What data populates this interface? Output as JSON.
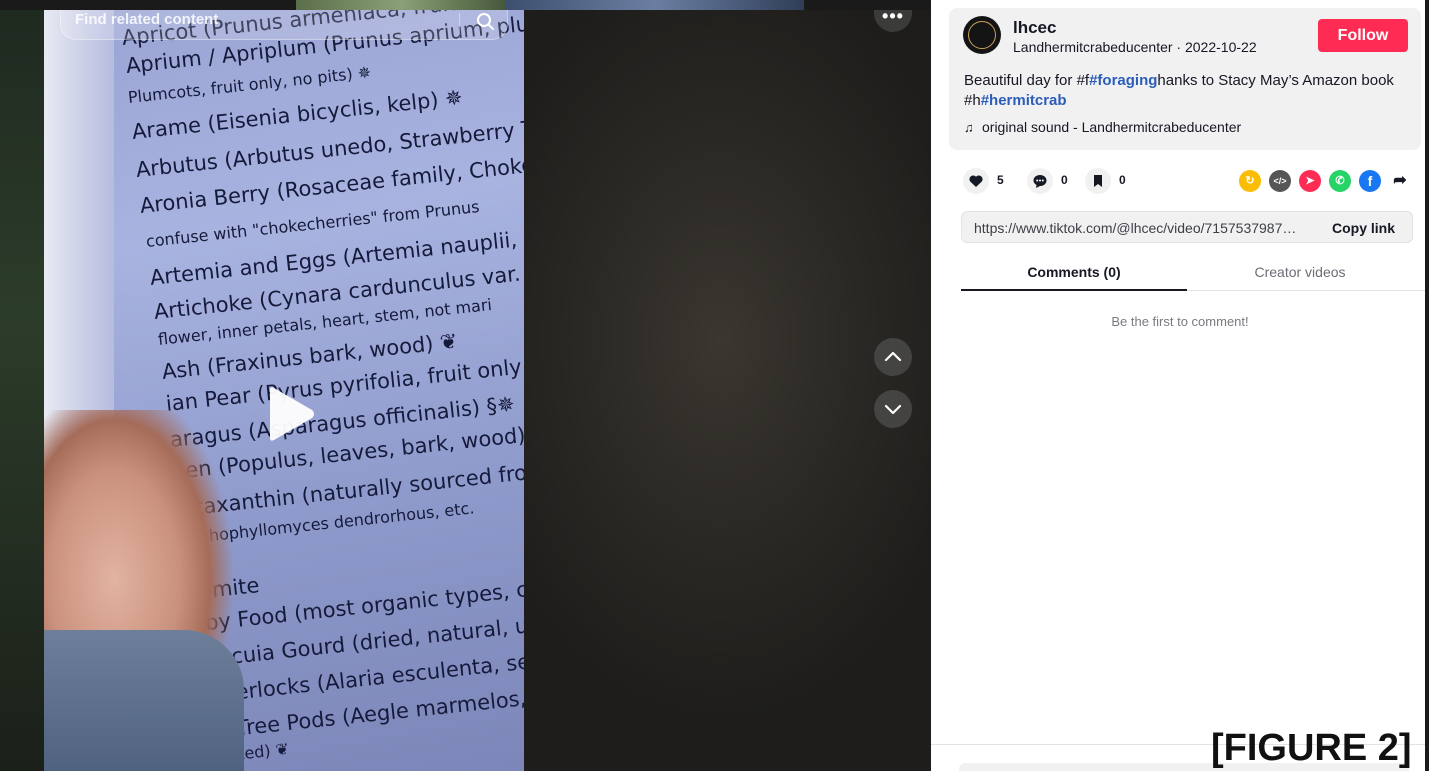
{
  "search": {
    "placeholder": "Find related content"
  },
  "book_text": [
    "Apricot (Prunus armeniaca, fruit only",
    "Aprium / Apriplum (Prunus aprium, plum",
    "Plumcots, fruit only, no pits) ✵",
    "Arame (Eisenia bicyclis, kelp) ✵",
    "Arbutus (Arbutus unedo, Strawberry Tree,",
    "Aronia Berry (Rosaceae family, Chokebe",
    "confuse with \"chokecherries\" from Prunus",
    "Artemia and Eggs (Artemia nauplii, Bri",
    "Artichoke (Cynara cardunculus var. sco",
    "flower, inner petals, heart, stem, not mari",
    "Ash (Fraxinus bark, wood) ❦",
    "ian Pear (Pyrus pyrifolia, fruit only, no",
    "aragus (Asparagus officinalis) §✵",
    "pen (Populus, leaves, bark, wood) ❦",
    "Astaxanthin (naturally sourced from H",
    "Xanthophyllomyces dendrorhous, etc.",
    "Azomite",
    "Baby Food (most organic types, ch",
    "Bacacuia Gourd (dried, natural, u",
    "Badderlocks (Alaria esculenta, sea",
    "Bael Tree Pods (Aegle marmelos,",
    "untreated) ❦"
  ],
  "author": {
    "name": "lhcec",
    "subtitle": "Landhermitcrabeducenter · 2022-10-22",
    "follow_label": "Follow"
  },
  "description": {
    "p1": "Beautiful day for #f",
    "tag1": "#foraging",
    "p2": "hanks to Stacy May’s Amazon book #h",
    "tag2": "#hermitcrab"
  },
  "sound": {
    "label": "original sound - Landhermitcrabeducenter"
  },
  "actions": {
    "likes": "5",
    "comments": "0",
    "saves": "0"
  },
  "share": {
    "icons": [
      "repost-icon",
      "embed-icon",
      "send-icon",
      "whatsapp-icon",
      "facebook-icon",
      "share-arrow-icon"
    ],
    "colors": {
      "repost": "#fbbc05",
      "embed": "#565656",
      "send": "#fe2c55",
      "whatsapp": "#25d366",
      "facebook": "#1877f2"
    }
  },
  "link": {
    "url": "https://www.tiktok.com/@lhcec/video/7157537987524...",
    "copy_label": "Copy link"
  },
  "tabs": {
    "comments": "Comments (0)",
    "creator": "Creator videos"
  },
  "comments": {
    "empty_text": "Be the first to comment!"
  },
  "figure_label": "[FIGURE 2]",
  "colors": {
    "accent": "#fe2c55",
    "hashtag": "#2b5db9"
  }
}
